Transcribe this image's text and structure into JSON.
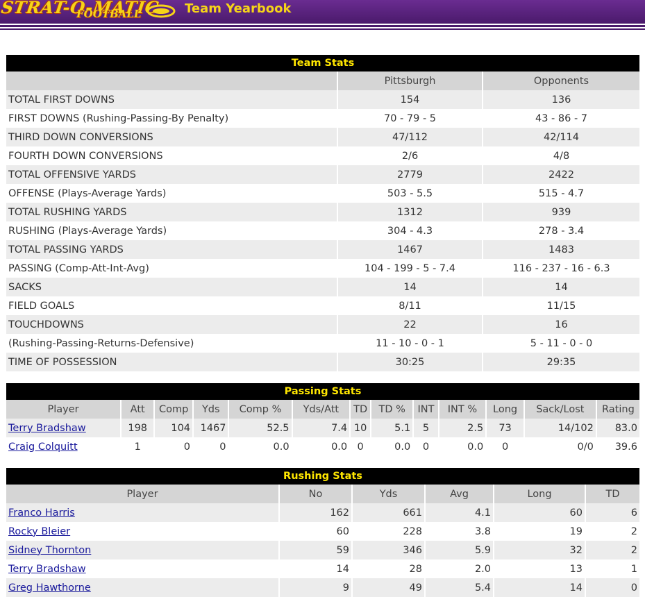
{
  "header": {
    "logo_text_top": "STRAT-O-MATIC",
    "logo_text_bottom": "FOOTBALL",
    "page_title": "Team Yearbook"
  },
  "team_stats": {
    "title": "Team Stats",
    "col_team": "Pittsburgh",
    "col_opp": "Opponents",
    "rows": [
      {
        "label": "TOTAL FIRST DOWNS",
        "team": "154",
        "opp": "136"
      },
      {
        "label": "FIRST DOWNS (Rushing-Passing-By Penalty)",
        "team": "70 - 79 - 5",
        "opp": "43 - 86 - 7"
      },
      {
        "label": "THIRD DOWN CONVERSIONS",
        "team": "47/112",
        "opp": "42/114"
      },
      {
        "label": "FOURTH DOWN CONVERSIONS",
        "team": "2/6",
        "opp": "4/8"
      },
      {
        "label": "TOTAL OFFENSIVE YARDS",
        "team": "2779",
        "opp": "2422"
      },
      {
        "label": "OFFENSE (Plays-Average Yards)",
        "team": "503 - 5.5",
        "opp": "515 - 4.7"
      },
      {
        "label": "TOTAL RUSHING YARDS",
        "team": "1312",
        "opp": "939"
      },
      {
        "label": "RUSHING (Plays-Average Yards)",
        "team": "304 - 4.3",
        "opp": "278 - 3.4"
      },
      {
        "label": "TOTAL PASSING YARDS",
        "team": "1467",
        "opp": "1483"
      },
      {
        "label": "PASSING (Comp-Att-Int-Avg)",
        "team": "104 - 199 - 5 - 7.4",
        "opp": "116 - 237 - 16 - 6.3"
      },
      {
        "label": "SACKS",
        "team": "14",
        "opp": "14"
      },
      {
        "label": "FIELD GOALS",
        "team": "8/11",
        "opp": "11/15"
      },
      {
        "label": "TOUCHDOWNS",
        "team": "22",
        "opp": "16"
      },
      {
        "label": "(Rushing-Passing-Returns-Defensive)",
        "team": "11 - 10 - 0 - 1",
        "opp": "5 - 11 - 0 - 0"
      },
      {
        "label": "TIME OF POSSESSION",
        "team": "30:25",
        "opp": "29:35"
      }
    ]
  },
  "passing_stats": {
    "title": "Passing Stats",
    "headers": [
      "Player",
      "Att",
      "Comp",
      "Yds",
      "Comp %",
      "Yds/Att",
      "TD",
      "TD %",
      "INT",
      "INT %",
      "Long",
      "Sack/Lost",
      "Rating"
    ],
    "rows": [
      [
        "Terry Bradshaw",
        "198",
        "104",
        "1467",
        "52.5",
        "7.4",
        "10",
        "5.1",
        "5",
        "2.5",
        "73",
        "14/102",
        "83.0"
      ],
      [
        "Craig Colquitt",
        "1",
        "0",
        "0",
        "0.0",
        "0.0",
        "0",
        "0.0",
        "0",
        "0.0",
        "0",
        "0/0",
        "39.6"
      ]
    ]
  },
  "rushing_stats": {
    "title": "Rushing Stats",
    "headers": [
      "Player",
      "No",
      "Yds",
      "Avg",
      "Long",
      "TD"
    ],
    "rows": [
      [
        "Franco Harris",
        "162",
        "661",
        "4.1",
        "60",
        "6"
      ],
      [
        "Rocky Bleier",
        "60",
        "228",
        "3.8",
        "19",
        "2"
      ],
      [
        "Sidney Thornton",
        "59",
        "346",
        "5.9",
        "32",
        "2"
      ],
      [
        "Terry Bradshaw",
        "14",
        "28",
        "2.0",
        "13",
        "1"
      ],
      [
        "Greg Hawthorne",
        "9",
        "49",
        "5.4",
        "14",
        "0"
      ]
    ]
  }
}
